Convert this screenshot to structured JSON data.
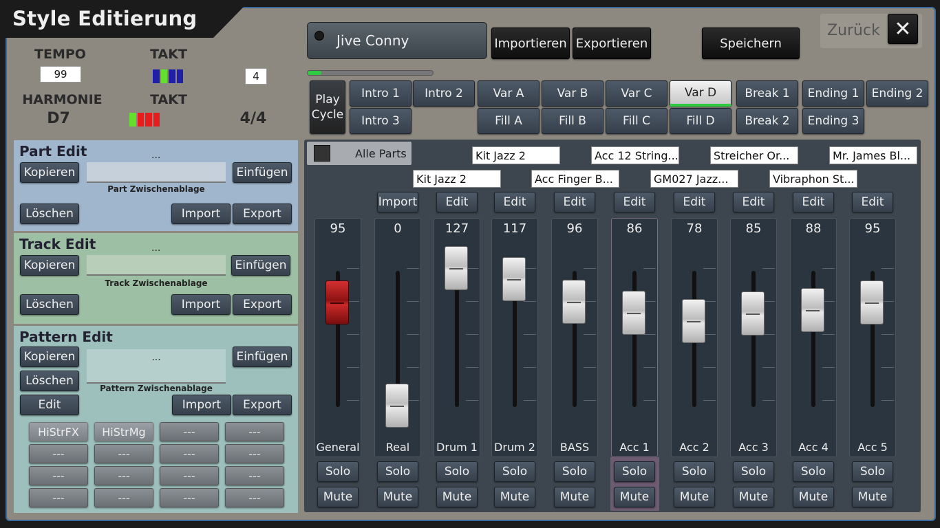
{
  "title": "Style Editierung",
  "header": {
    "style_name": "Jive Conny",
    "import_label": "Importieren",
    "export_label": "Exportieren",
    "save_label": "Speichern",
    "back_label": "Zurück",
    "progress": 0.11
  },
  "info": {
    "tempo_label": "TEMPO",
    "tempo_value": "99",
    "takt_label": "TAKT",
    "takt_value": "4",
    "harmonie_label": "HARMONIE",
    "harmonie_value": "D7",
    "takt2_label": "TAKT",
    "takt2_value": "4/4"
  },
  "part_edit": {
    "title": "Part Edit",
    "dots": "...",
    "copy": "Kopieren",
    "paste": "Einfügen",
    "clipboard": "Part Zwischenablage",
    "delete": "Löschen",
    "import": "Import",
    "export": "Export"
  },
  "track_edit": {
    "title": "Track Edit",
    "dots": "...",
    "copy": "Kopieren",
    "paste": "Einfügen",
    "clipboard": "Track Zwischenablage",
    "delete": "Löschen",
    "import": "Import",
    "export": "Export"
  },
  "pattern_edit": {
    "title": "Pattern Edit",
    "dots": "...",
    "copy": "Kopieren",
    "paste": "Einfügen",
    "clipboard": "Pattern Zwischenablage",
    "delete": "Löschen",
    "edit": "Edit",
    "import": "Import",
    "export": "Export",
    "slots": [
      "HiStrFX",
      "HiStrMg",
      "---",
      "---",
      "---",
      "---",
      "---",
      "---",
      "---",
      "---",
      "---",
      "---",
      "---",
      "---",
      "---",
      "---"
    ]
  },
  "parts": {
    "play_cycle": "Play Cycle",
    "row1": [
      "Intro 1",
      "Intro 2",
      "Var A",
      "Var B",
      "Var C",
      "Var D",
      "Break 1",
      "Ending 1",
      "Ending 2"
    ],
    "row2": [
      "Intro 3",
      "Fill A",
      "Fill B",
      "Fill C",
      "Fill D",
      "Break 2",
      "Ending 3"
    ],
    "active": "Var D"
  },
  "mixer": {
    "alle_parts": "Alle Parts",
    "names_top": [
      "Kit Jazz 2",
      "Acc 12 String...",
      "Streicher Or...",
      "Mr. James Bl..."
    ],
    "names_bottom": [
      "Kit Jazz 2",
      "Acc Finger B...",
      "GM027 Jazz...",
      "Vibraphon St..."
    ],
    "import_label": "Import",
    "edit_label": "Edit",
    "solo_label": "Solo",
    "mute_label": "Mute",
    "channels": [
      {
        "name": "General",
        "value": "95",
        "level": 95
      },
      {
        "name": "Real",
        "value": "0",
        "level": 0
      },
      {
        "name": "Drum 1",
        "value": "127",
        "level": 127
      },
      {
        "name": "Drum 2",
        "value": "117",
        "level": 117
      },
      {
        "name": "BASS",
        "value": "96",
        "level": 96
      },
      {
        "name": "Acc 1",
        "value": "86",
        "level": 86
      },
      {
        "name": "Acc 2",
        "value": "78",
        "level": 78
      },
      {
        "name": "Acc 3",
        "value": "85",
        "level": 85
      },
      {
        "name": "Acc 4",
        "value": "88",
        "level": 88
      },
      {
        "name": "Acc 5",
        "value": "95",
        "level": 95
      }
    ]
  },
  "colors": {
    "active_part": "#2ecc40",
    "general_knob": "#b81c1c"
  }
}
